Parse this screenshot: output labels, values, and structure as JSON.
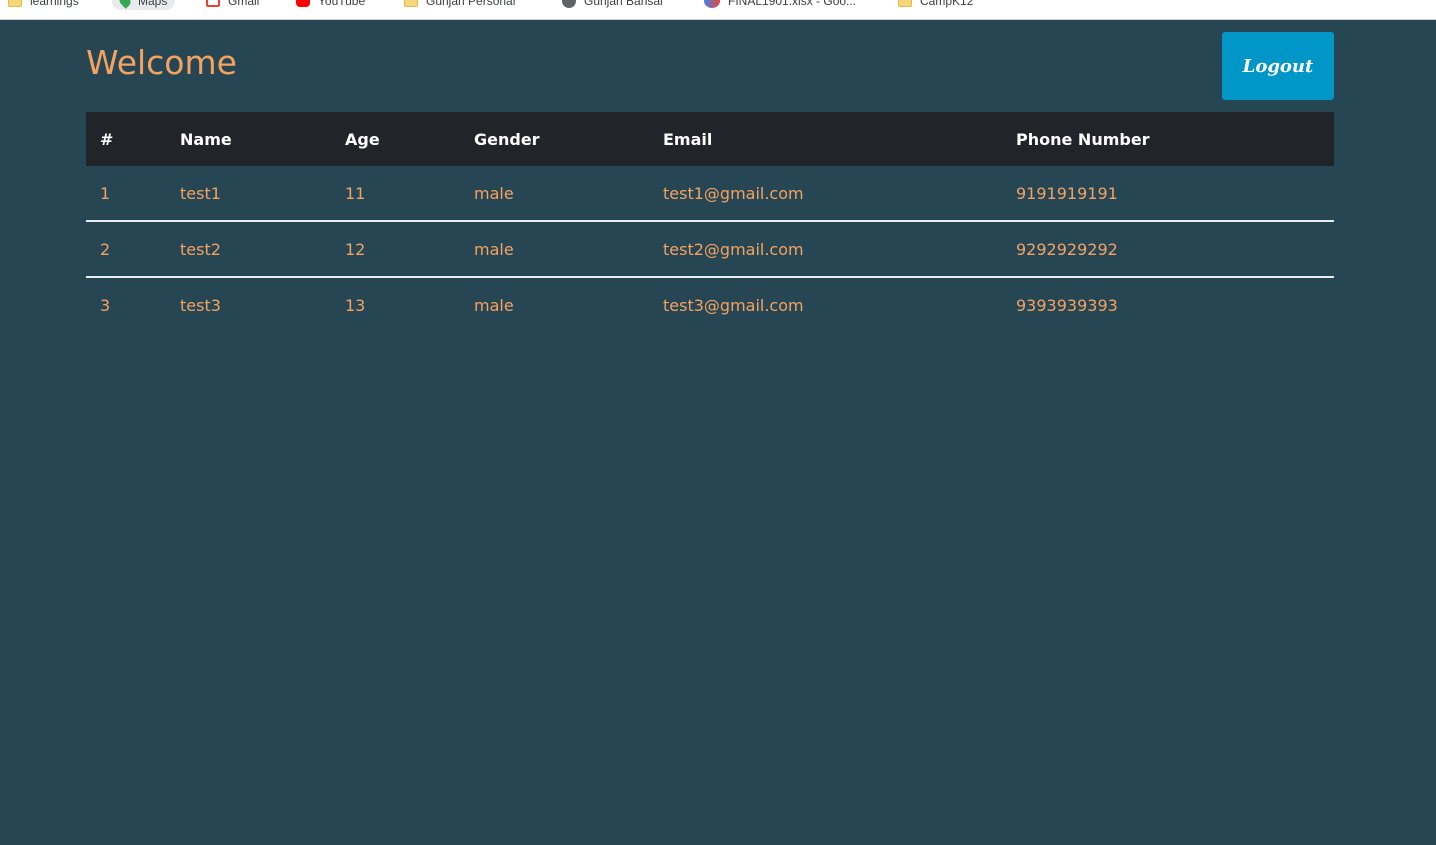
{
  "bookmarks": [
    {
      "label": "learnings",
      "icon": "folder-icon"
    },
    {
      "label": "Maps",
      "icon": "maps-icon"
    },
    {
      "label": "Gmail",
      "icon": "gmail-icon"
    },
    {
      "label": "YouTube",
      "icon": "youtube-icon"
    },
    {
      "label": "Gunjan Personal",
      "icon": "folder-icon"
    },
    {
      "label": "Gunjan Bansal",
      "icon": "globe-icon"
    },
    {
      "label": "FINAL1901.xlsx - Goo...",
      "icon": "sheets-icon"
    },
    {
      "label": "CampK12",
      "icon": "folder-icon"
    }
  ],
  "header": {
    "title": "Welcome",
    "logout_label": "Logout"
  },
  "table": {
    "columns": [
      "#",
      "Name",
      "Age",
      "Gender",
      "Email",
      "Phone Number"
    ],
    "rows": [
      [
        "1",
        "test1",
        "11",
        "male",
        "test1@gmail.com",
        "9191919191"
      ],
      [
        "2",
        "test2",
        "12",
        "male",
        "test2@gmail.com",
        "9292929292"
      ],
      [
        "3",
        "test3",
        "13",
        "male",
        "test3@gmail.com",
        "9393939393"
      ]
    ]
  },
  "colors": {
    "background": "#264653",
    "accent": "#f4a261",
    "button": "#0096c7",
    "table_header": "#212529"
  }
}
